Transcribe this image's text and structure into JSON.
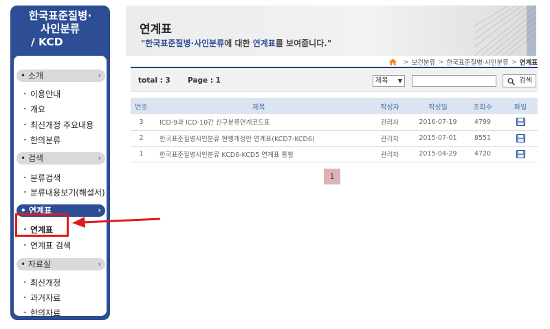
{
  "sidebar": {
    "title_line1": "한국표준질병·",
    "title_line2": "사인분류",
    "title_line3": "/ KCD",
    "categories": [
      {
        "label": "소개",
        "items": [
          "이용안내",
          "개요",
          "최신개정 주요내용",
          "한의분류"
        ]
      },
      {
        "label": "검색",
        "items": [
          "분류검색",
          "분류내용보기(해설서)"
        ]
      },
      {
        "label": "연계표",
        "items": [
          "연계표",
          "연계표 검색"
        ]
      },
      {
        "label": "자료실",
        "items": [
          "최신개정",
          "과거자료",
          "한의자료"
        ]
      }
    ],
    "arrow": "›"
  },
  "header": {
    "title": "연계표",
    "desc_quote_open": "\"",
    "desc_highlight1": "한국표준질병·사인분류",
    "desc_mid": "에 대한 ",
    "desc_highlight2": "연계표",
    "desc_end": "를 보여줍니다.\""
  },
  "breadcrumb": {
    "items": [
      "보건분류",
      "한국표준질병·사인분류",
      "연계표"
    ],
    "separator": ">"
  },
  "toolbar": {
    "total": "total : 3",
    "page": "Page : 1",
    "select_value": "제목",
    "search_label": "검색"
  },
  "table": {
    "headers": [
      "번호",
      "제목",
      "작성자",
      "작성일",
      "조회수",
      "파일"
    ],
    "rows": [
      {
        "no": "3",
        "title": "ICD-9과 ICD-10간 신구분류연계코드표",
        "author": "관리자",
        "date": "2016-07-19",
        "views": "4799"
      },
      {
        "no": "2",
        "title": "한국표준질병사인분류 현행개정안 연계표(KCD7-KCD6)",
        "author": "관리자",
        "date": "2015-07-01",
        "views": "8551"
      },
      {
        "no": "1",
        "title": "한국표준질병사인분류 KCD6-KCD5 연계표 통합",
        "author": "관리자",
        "date": "2015-04-29",
        "views": "4720"
      }
    ]
  },
  "pagination": {
    "current": "1"
  },
  "icons": {
    "home": "home-icon",
    "search": "search-icon",
    "file": "disk-file-icon",
    "arrow": "red-arrow-pointer"
  },
  "colors": {
    "brand": "#2d4e94",
    "highlight": "#e01a1a",
    "pager": "#d9b3b7"
  }
}
